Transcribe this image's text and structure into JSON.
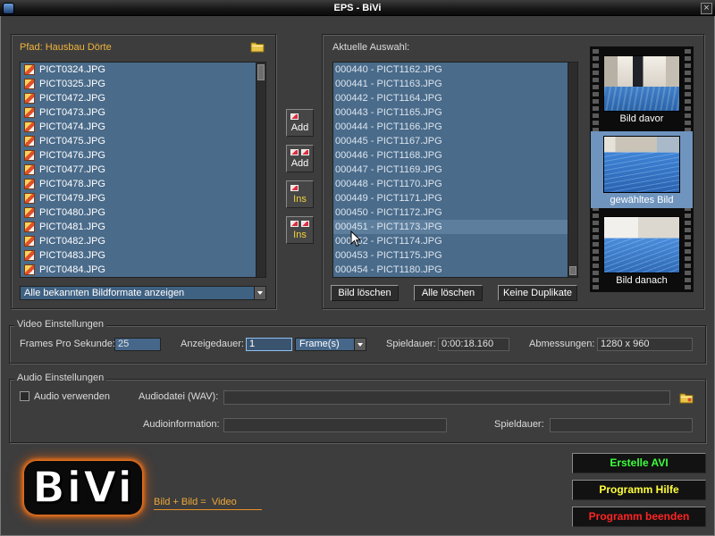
{
  "window": {
    "title": "EPS - BiVi",
    "app_icon": "app-icon",
    "close_icon": "close-icon"
  },
  "source": {
    "path_label": "Pfad: Hausbau Dörte",
    "browse_icon": "folder-icon",
    "file_icon": "image-file-icon",
    "files": [
      "PICT0324.JPG",
      "PICT0325.JPG",
      "PICT0472.JPG",
      "PICT0473.JPG",
      "PICT0474.JPG",
      "PICT0475.JPG",
      "PICT0476.JPG",
      "PICT0477.JPG",
      "PICT0478.JPG",
      "PICT0479.JPG",
      "PICT0480.JPG",
      "PICT0481.JPG",
      "PICT0482.JPG",
      "PICT0483.JPG",
      "PICT0484.JPG"
    ],
    "filter_selected": "Alle bekannten Bildformate anzeigen"
  },
  "transfer": {
    "add_single": {
      "label": "Add",
      "icon": "single-image-icon"
    },
    "add_multiple": {
      "label": "Add",
      "icon": "multiple-images-icon"
    },
    "insert_single": {
      "label": "Ins",
      "icon": "single-image-icon"
    },
    "insert_multiple": {
      "label": "Ins",
      "icon": "multiple-images-icon"
    }
  },
  "selection": {
    "label": "Aktuelle Auswahl:",
    "items": [
      {
        "label": "000440 - PICT1162.JPG",
        "highlighted": false
      },
      {
        "label": "000441 - PICT1163.JPG",
        "highlighted": false
      },
      {
        "label": "000442 - PICT1164.JPG",
        "highlighted": false
      },
      {
        "label": "000443 - PICT1165.JPG",
        "highlighted": false
      },
      {
        "label": "000444 - PICT1166.JPG",
        "highlighted": false
      },
      {
        "label": "000445 - PICT1167.JPG",
        "highlighted": false
      },
      {
        "label": "000446 - PICT1168.JPG",
        "highlighted": false
      },
      {
        "label": "000447 - PICT1169.JPG",
        "highlighted": false
      },
      {
        "label": "000448 - PICT1170.JPG",
        "highlighted": false
      },
      {
        "label": "000449 - PICT1171.JPG",
        "highlighted": false
      },
      {
        "label": "000450 - PICT1172.JPG",
        "highlighted": false
      },
      {
        "label": "000451 - PICT1173.JPG",
        "highlighted": true
      },
      {
        "label": "000452 - PICT1174.JPG",
        "highlighted": false
      },
      {
        "label": "000453 - PICT1175.JPG",
        "highlighted": false
      },
      {
        "label": "000454 - PICT1180.JPG",
        "highlighted": false
      }
    ],
    "delete_label": "Bild löschen",
    "delete_all_label": "Alle löschen",
    "no_duplicates_label": "Keine Duplikate"
  },
  "preview": {
    "previous_label": "Bild davor",
    "current_label": "gewähltes Bild",
    "next_label": "Bild danach"
  },
  "video": {
    "legend": "Video Einstellungen",
    "fps_label": "Frames Pro Sekunde:",
    "fps_value": "25",
    "duration_label": "Anzeigedauer:",
    "duration_value": "1",
    "duration_unit": "Frame(s)",
    "playtime_label": "Spieldauer:",
    "playtime_value": "0:00:18.160",
    "dimensions_label": "Abmessungen:",
    "dimensions_value": "1280 x 960"
  },
  "audio": {
    "legend": "Audio Einstellungen",
    "use_audio_label": "Audio verwenden",
    "use_audio_checked": false,
    "file_label": "Audiodatei (WAV):",
    "file_value": "",
    "browse_icon": "folder-icon",
    "info_label": "Audioinformation:",
    "info_value": "",
    "playtime_label": "Spieldauer:",
    "playtime_value": ""
  },
  "branding": {
    "logo_text": "BiVi",
    "tagline": "Bild + Bild =  Video"
  },
  "actions": {
    "create_label": "Erstelle AVI",
    "help_label": "Programm Hilfe",
    "quit_label": "Programm beenden"
  },
  "colors": {
    "window_background": "#3d3d3d",
    "list_background": "#4a6b8a",
    "highlight_row": "#5d7e9d",
    "path_label": "#f0b43c",
    "insert_label": "#f2d23c",
    "create_text": "#3cff3c",
    "help_text": "#ffff3c",
    "quit_text": "#ff2424",
    "logo_glow": "#ff7a1a",
    "selected_frame": "#6f95bf",
    "tagline": "#f0a838"
  }
}
